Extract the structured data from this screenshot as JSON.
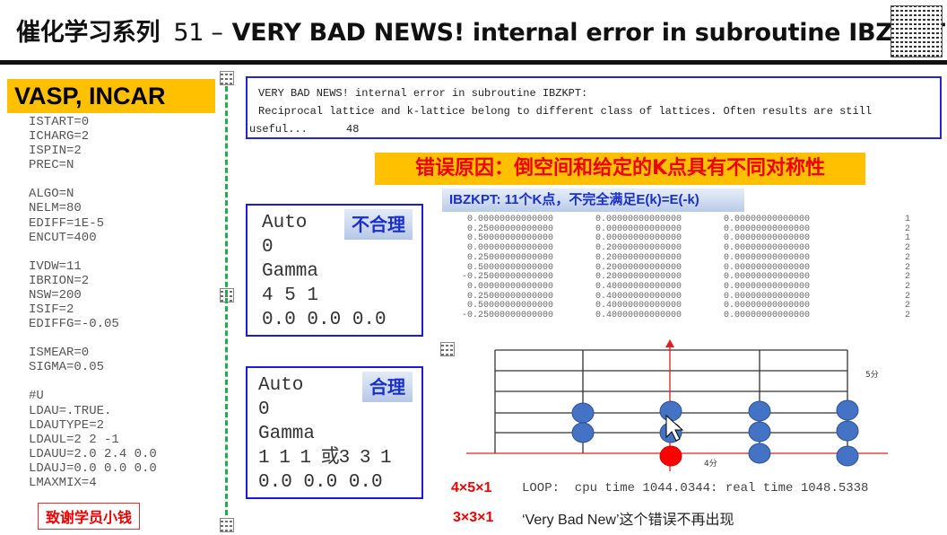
{
  "header": {
    "series": "催化学习系列",
    "number": "51 –",
    "title": "VERY BAD NEWS! internal error in subroutine IBZKPT"
  },
  "incar": {
    "title": "VASP, INCAR",
    "lines": [
      "ISTART=0",
      "ICHARG=2",
      "ISPIN=2",
      "PREC=N",
      "",
      "ALGO=N",
      "NELM=80",
      "EDIFF=1E-5",
      "ENCUT=400",
      "",
      "IVDW=11",
      "IBRION=2",
      "NSW=200",
      "ISIF=2",
      "EDIFFG=-0.05",
      "",
      "ISMEAR=0",
      "SIGMA=0.05",
      "",
      "#U",
      "LDAU=.TRUE.",
      "LDAUTYPE=2",
      "LDAUL=2 2 -1",
      "LDAUU=2.0 2.4 0.0",
      "LDAUJ=0.0 0.0 0.0",
      "LMAXMIX=4"
    ],
    "thanks": "致谢学员小钱"
  },
  "error": {
    "line1": "VERY BAD NEWS! internal error in subroutine IBZKPT:",
    "line2": "Reciprocal lattice and k-lattice belong to different class of lattices. Often results are still",
    "line3": "useful...      48"
  },
  "cause": "错误原因：倒空间和给定的K点具有不同对称性",
  "ibzkpt_label": "IBZKPT: 11个K点，不完全满足E(k)=E(-k)",
  "kpoints": [
    [
      "0.00000000000000",
      "0.00000000000000",
      "0.00000000000000",
      "1"
    ],
    [
      "0.25000000000000",
      "0.00000000000000",
      "0.00000000000000",
      "2"
    ],
    [
      "0.50000000000000",
      "0.00000000000000",
      "0.00000000000000",
      "1"
    ],
    [
      "0.00000000000000",
      "0.20000000000000",
      "0.00000000000000",
      "2"
    ],
    [
      "0.25000000000000",
      "0.20000000000000",
      "0.00000000000000",
      "2"
    ],
    [
      "0.50000000000000",
      "0.20000000000000",
      "0.00000000000000",
      "2"
    ],
    [
      "-0.25000000000000",
      "0.20000000000000",
      "0.00000000000000",
      "2"
    ],
    [
      "0.00000000000000",
      "0.40000000000000",
      "0.00000000000000",
      "2"
    ],
    [
      "0.25000000000000",
      "0.40000000000000",
      "0.00000000000000",
      "2"
    ],
    [
      "0.50000000000000",
      "0.40000000000000",
      "0.00000000000000",
      "2"
    ],
    [
      "-0.25000000000000",
      "0.40000000000000",
      "0.00000000000000",
      "2"
    ]
  ],
  "kpoints_bad": {
    "tag": "不合理",
    "lines": [
      "Auto",
      "0",
      "Gamma",
      "4 5 1",
      "0.0 0.0 0.0"
    ]
  },
  "kpoints_good": {
    "tag": "合理",
    "lines": [
      "Auto",
      "0",
      "Gamma",
      "1 1 1 或3 3 1",
      "0.0 0.0 0.0"
    ]
  },
  "diagram": {
    "label_5": "5分",
    "label_4": "4分",
    "dot_color": "#4472c4",
    "origin_color": "#ff0000",
    "axis_color": "#e02020"
  },
  "results": {
    "dim1": "4×5×1",
    "loop": "LOOP:  cpu time 1044.0344: real time 1048.5338",
    "dim2": "3×3×1",
    "note": "‘Very Bad New’这个错误不再出现"
  }
}
